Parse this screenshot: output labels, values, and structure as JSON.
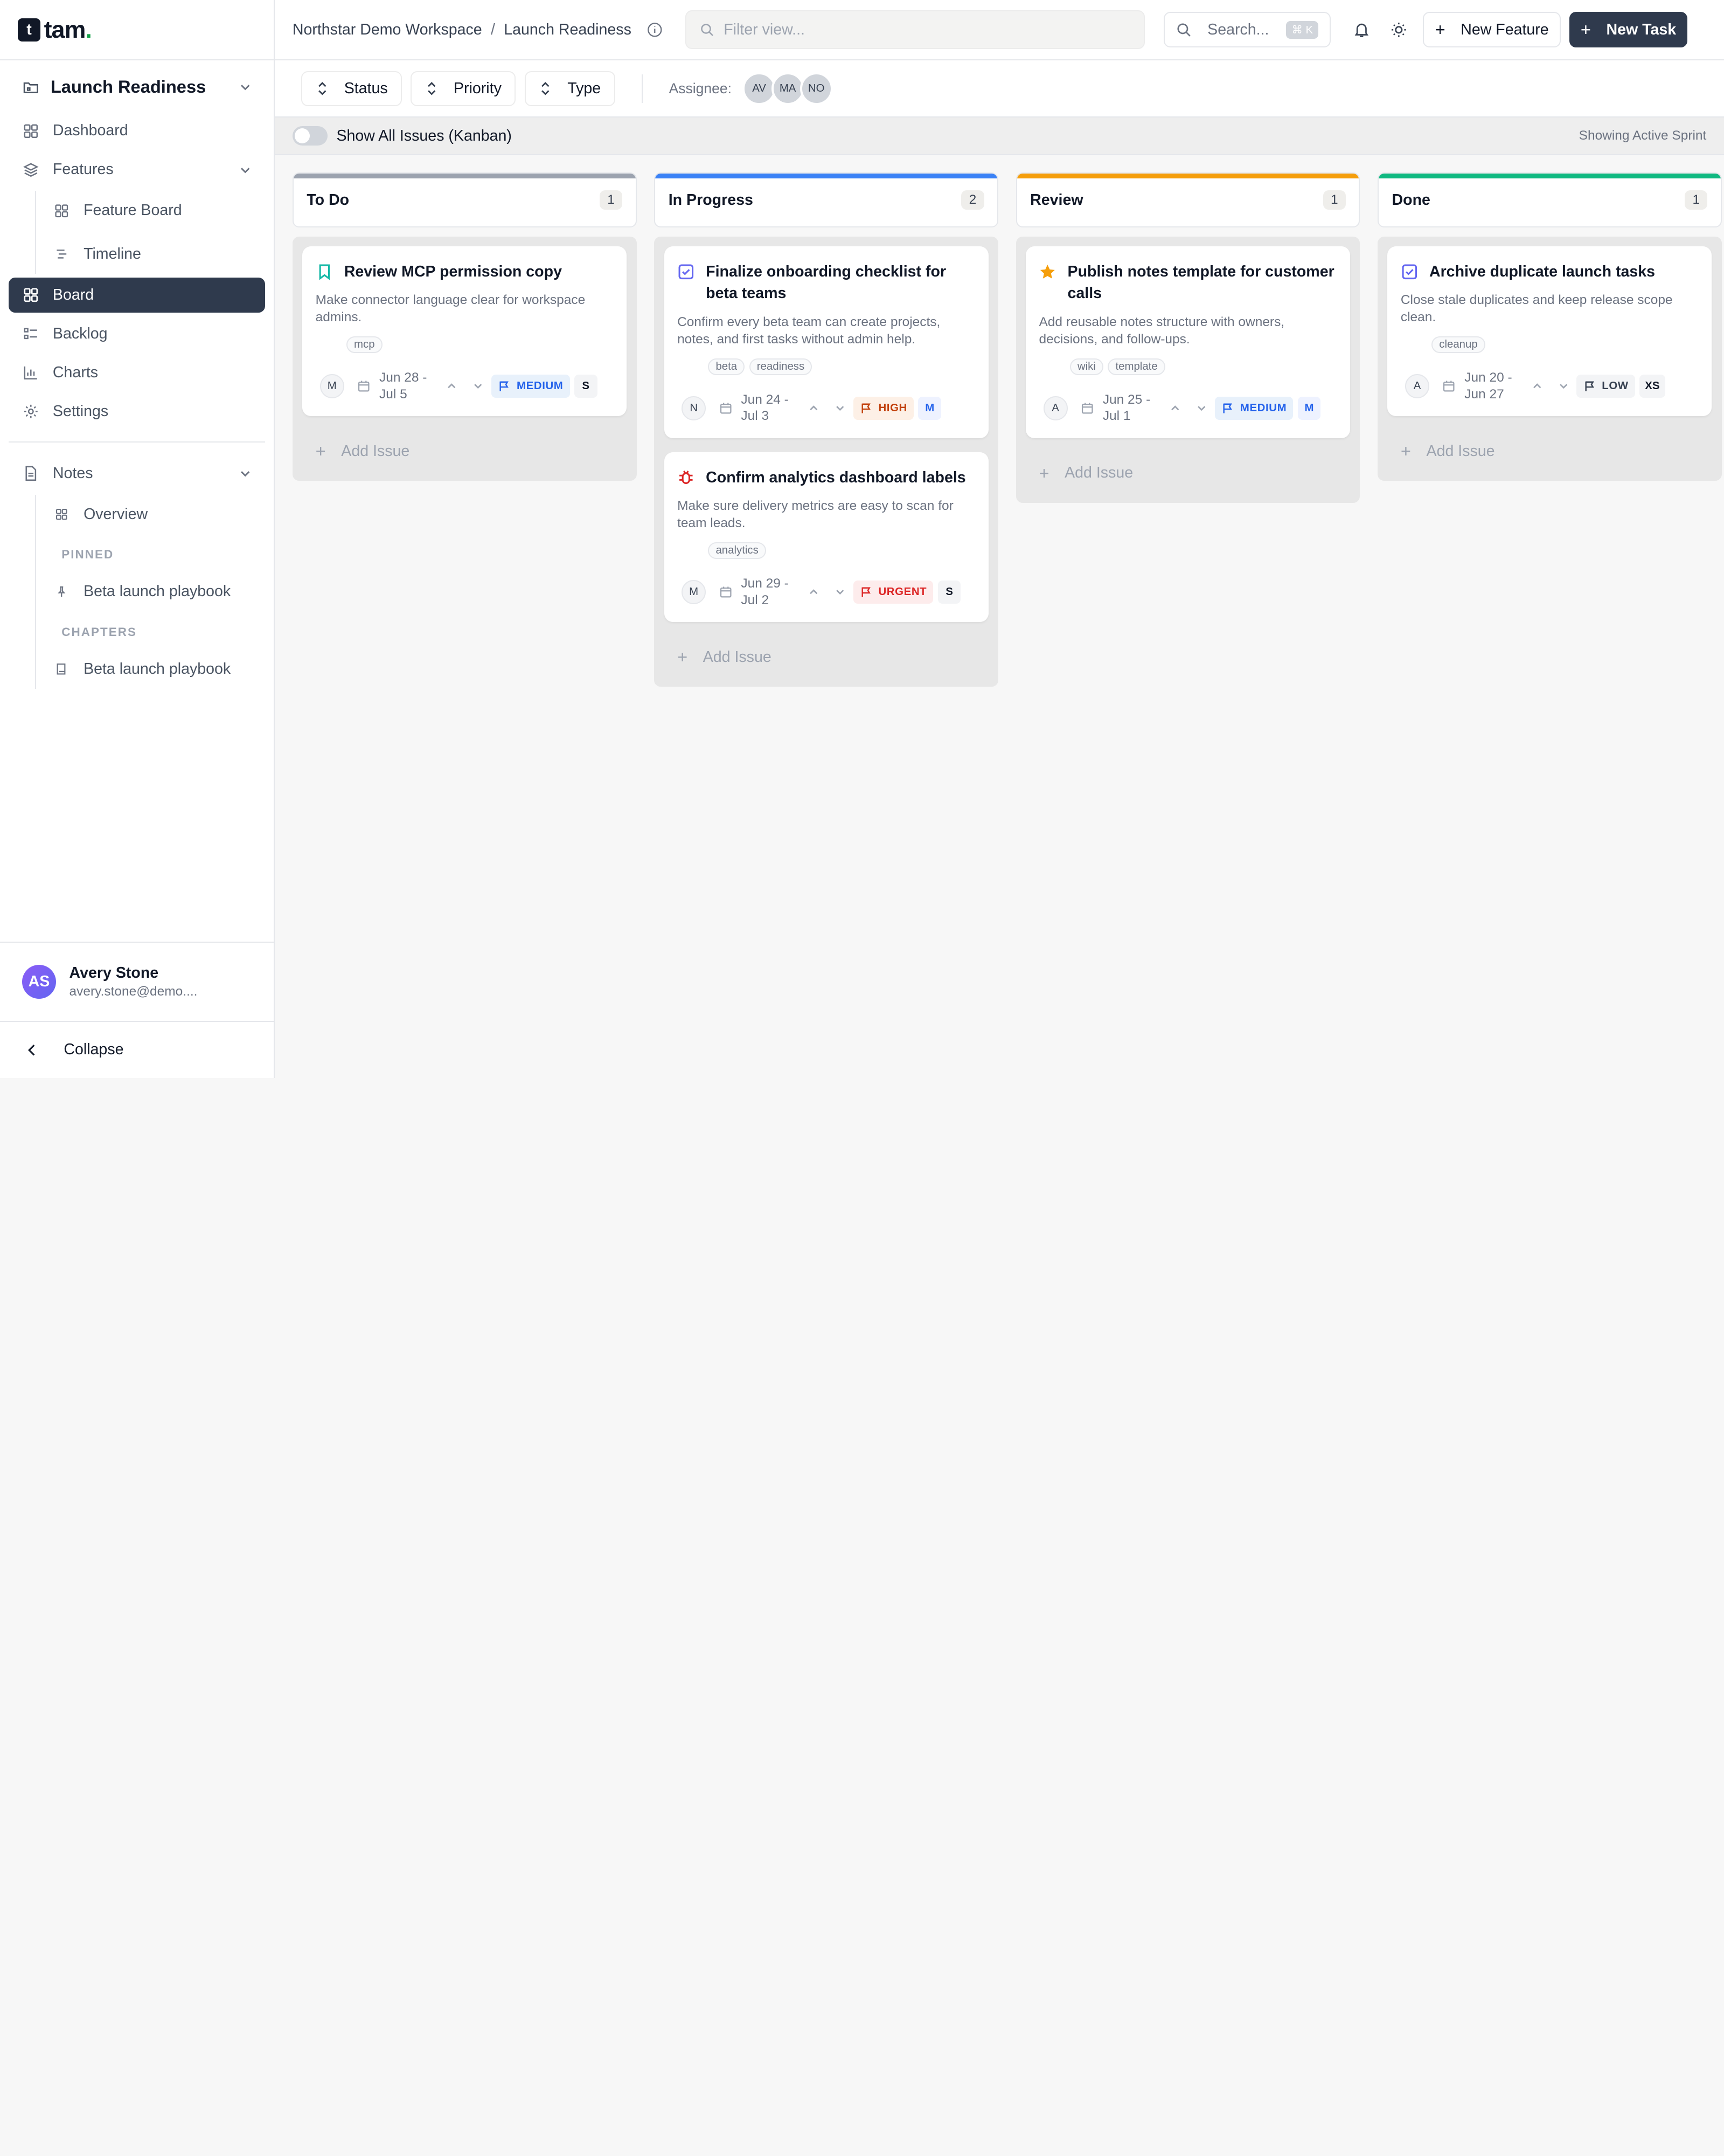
{
  "app": {
    "logo_letter": "t",
    "logo_name": "tam",
    "logo_dot": "."
  },
  "sidebar": {
    "project": "Launch Readiness",
    "items": {
      "dashboard": "Dashboard",
      "features": "Features",
      "feature_board": "Feature Board",
      "timeline": "Timeline",
      "board": "Board",
      "backlog": "Backlog",
      "charts": "Charts",
      "settings": "Settings",
      "notes": "Notes",
      "overview": "Overview",
      "pinned_label": "PINNED",
      "pinned_item": "Beta launch playbook",
      "chapters_label": "CHAPTERS",
      "chapter_item": "Beta launch playbook"
    },
    "user": {
      "initials": "AS",
      "name": "Avery Stone",
      "email": "avery.stone@demo...."
    },
    "collapse": "Collapse"
  },
  "topbar": {
    "workspace": "Northstar Demo Workspace",
    "separator": "/",
    "page": "Launch Readiness",
    "filter_placeholder": "Filter view...",
    "search_label": "Search...",
    "search_kbd": "⌘ K",
    "new_feature": "New Feature",
    "new_task": "New Task"
  },
  "filters": {
    "status": "Status",
    "priority": "Priority",
    "type": "Type",
    "assignee_label": "Assignee:",
    "assignees": [
      "AV",
      "MA",
      "NO"
    ]
  },
  "toggle": {
    "label": "Show All Issues (Kanban)",
    "note": "Showing Active Sprint"
  },
  "columns": [
    {
      "title": "To Do",
      "count": "1",
      "accent": "#9ca3af",
      "cards": [
        {
          "title": "Review MCP permission copy",
          "desc": "Make connector language clear for workspace admins.",
          "tags": [
            "mcp"
          ],
          "assignee": "M",
          "dates": "Jun 28 - Jul 5",
          "priority": "MEDIUM",
          "size": "S"
        }
      ]
    },
    {
      "title": "In Progress",
      "count": "2",
      "accent": "#3b82f6",
      "cards": [
        {
          "title": "Finalize onboarding checklist for beta teams",
          "desc": "Confirm every beta team can create projects, notes, and first tasks without admin help.",
          "tags": [
            "beta",
            "readiness"
          ],
          "assignee": "N",
          "dates": "Jun 24 - Jul 3",
          "priority": "HIGH",
          "size": "M"
        },
        {
          "title": "Confirm analytics dashboard labels",
          "desc": "Make sure delivery metrics are easy to scan for team leads.",
          "tags": [
            "analytics"
          ],
          "assignee": "M",
          "dates": "Jun 29 - Jul 2",
          "priority": "URGENT",
          "size": "S"
        }
      ]
    },
    {
      "title": "Review",
      "count": "1",
      "accent": "#f59e0b",
      "cards": [
        {
          "title": "Publish notes template for customer calls",
          "desc": "Add reusable notes structure with owners, decisions, and follow-ups.",
          "tags": [
            "wiki",
            "template"
          ],
          "assignee": "A",
          "dates": "Jun 25 - Jul 1",
          "priority": "MEDIUM",
          "size": "M"
        }
      ]
    },
    {
      "title": "Done",
      "count": "1",
      "accent": "#10b981",
      "cards": [
        {
          "title": "Archive duplicate launch tasks",
          "desc": "Close stale duplicates and keep release scope clean.",
          "tags": [
            "cleanup"
          ],
          "assignee": "A",
          "dates": "Jun 20 - Jun 27",
          "priority": "LOW",
          "size": "XS"
        }
      ]
    }
  ],
  "add_issue": "Add Issue"
}
